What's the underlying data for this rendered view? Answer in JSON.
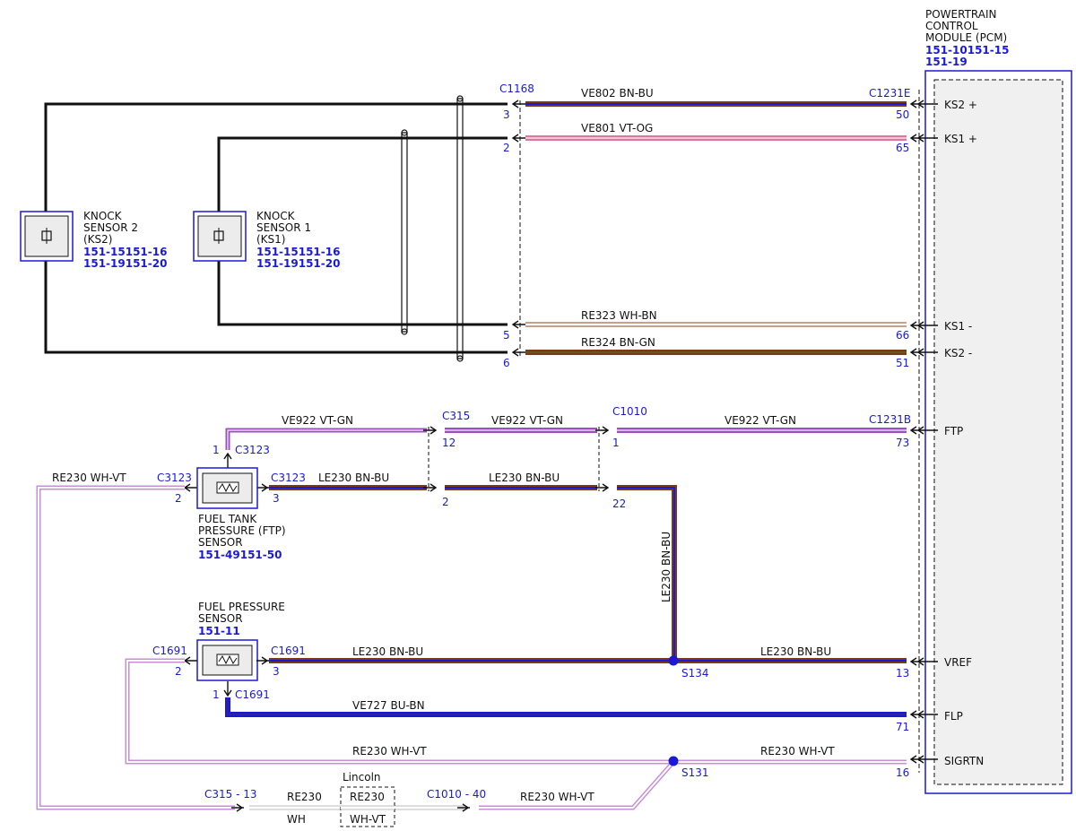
{
  "pcm": {
    "title_lines": [
      "POWERTRAIN",
      "CONTROL",
      "MODULE (PCM)"
    ],
    "refs": [
      "151-10151-15",
      "151-19"
    ],
    "pins": {
      "ks2_plus": "KS2 +",
      "ks1_plus": "KS1 +",
      "ks1_minus": "KS1 -",
      "ks2_minus": "KS2 -",
      "ftp": "FTP",
      "vref": "VREF",
      "flp": "FLP",
      "sigrtn": "SIGRTN"
    }
  },
  "knock_sensor_2": {
    "lines": [
      "KNOCK",
      "SENSOR 2",
      "(KS2)"
    ],
    "refs": [
      "151-15151-16",
      "151-19151-20"
    ]
  },
  "knock_sensor_1": {
    "lines": [
      "KNOCK",
      "SENSOR 1",
      "(KS1)"
    ],
    "refs": [
      "151-15151-16",
      "151-19151-20"
    ]
  },
  "ftp_sensor": {
    "lines": [
      "FUEL TANK",
      "PRESSURE (FTP)",
      "SENSOR"
    ],
    "ref": "151-49151-50"
  },
  "fp_sensor": {
    "lines": [
      "FUEL PRESSURE",
      "SENSOR"
    ],
    "ref": "151-11"
  },
  "connectors": {
    "c1168": "C1168",
    "c1231e": "C1231E",
    "c315": "C315",
    "c1010": "C1010",
    "c1231b": "C1231B",
    "c3123": "C3123",
    "c1691": "C1691",
    "c315_13": "C315 - 13",
    "c1010_40": "C1010 - 40"
  },
  "splices": {
    "s134": "S134",
    "s131": "S131"
  },
  "pins": {
    "p3": "3",
    "p2": "2",
    "p5": "5",
    "p6": "6",
    "p50": "50",
    "p65": "65",
    "p66": "66",
    "p51": "51",
    "p1": "1",
    "p12": "12",
    "p73": "73",
    "p22": "22",
    "p13": "13",
    "p71": "71",
    "p16": "16"
  },
  "wires": {
    "ve802": "VE802  BN-BU",
    "ve801": "VE801  VT-OG",
    "re323": "RE323  WH-BN",
    "re324": "RE324  BN-GN",
    "ve922": "VE922  VT-GN",
    "le230": "LE230  BN-BU",
    "ve727": "VE727  BU-BN",
    "re230_whvt": "RE230  WH-VT",
    "re230": "RE230",
    "wh": "WH",
    "whvt": "WH-VT"
  },
  "lincoln": "Lincoln",
  "colors": {
    "connector_blue": "#1a1ad6",
    "bn": "#7a3a14",
    "bu": "#1a1ad6",
    "vt": "#9b4fc0",
    "og": "#e8a0b8",
    "wh": "#ffffff",
    "gn": "#2e8b2e"
  }
}
